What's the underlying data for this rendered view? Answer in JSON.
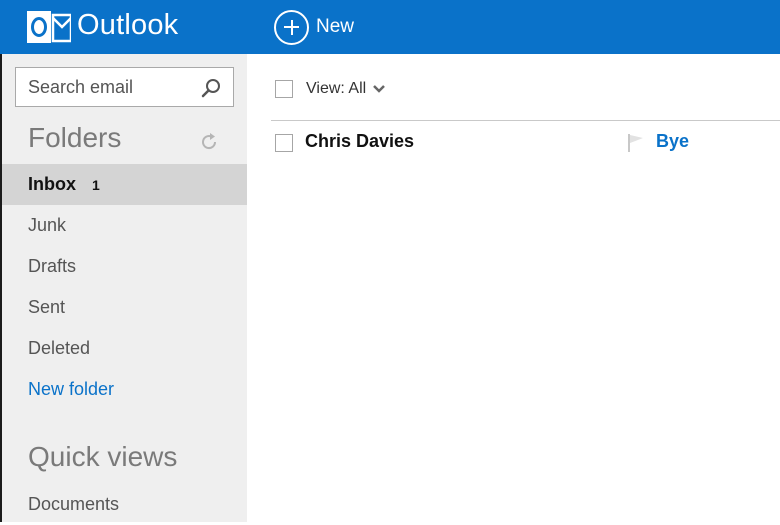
{
  "app": {
    "brand": "Outlook",
    "new_label": "New",
    "accent_color": "#0a72c9"
  },
  "search": {
    "placeholder": "Search email",
    "icon": "search-icon"
  },
  "sidebar": {
    "folders_title": "Folders",
    "folders": [
      {
        "label": "Inbox",
        "count": "1",
        "selected": true
      },
      {
        "label": "Junk"
      },
      {
        "label": "Drafts"
      },
      {
        "label": "Sent"
      },
      {
        "label": "Deleted"
      }
    ],
    "new_folder": "New folder",
    "quick_views_title": "Quick views",
    "quick_views": [
      {
        "label": "Documents"
      }
    ]
  },
  "toolbar": {
    "view_label": "View: All"
  },
  "messages": [
    {
      "sender": "Chris Davies",
      "subject": "Bye",
      "unread": true
    }
  ]
}
